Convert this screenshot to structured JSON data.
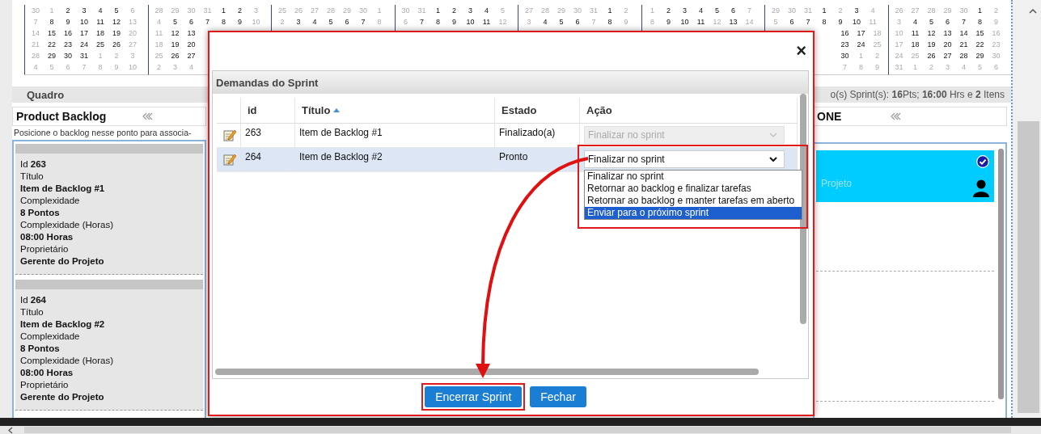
{
  "calendar": {
    "months": [
      {
        "kind": "whole",
        "weeks": [
          {
            "days": [
              "30",
              "1",
              "2",
              "3",
              "4",
              "5",
              "6"
            ],
            "muted": [
              true,
              true,
              false,
              false,
              false,
              false,
              true
            ]
          },
          {
            "days": [
              "7",
              "8",
              "9",
              "10",
              "11",
              "12",
              "13"
            ],
            "muted": [
              true,
              false,
              false,
              false,
              false,
              false,
              true
            ]
          },
          {
            "days": [
              "14",
              "15",
              "16",
              "17",
              "18",
              "19",
              "20"
            ],
            "muted": [
              true,
              false,
              false,
              false,
              false,
              false,
              true
            ]
          },
          {
            "days": [
              "21",
              "22",
              "23",
              "24",
              "25",
              "26",
              "27"
            ],
            "muted": [
              true,
              false,
              false,
              false,
              false,
              false,
              true
            ]
          },
          {
            "days": [
              "28",
              "29",
              "30",
              "31",
              "1",
              "2",
              "3"
            ],
            "muted": [
              true,
              false,
              false,
              false,
              true,
              true,
              true
            ]
          },
          {
            "days": [
              "4",
              "5",
              "6",
              "7",
              "8",
              "9",
              "10"
            ],
            "muted": [
              true,
              true,
              true,
              true,
              true,
              true,
              true
            ]
          }
        ]
      },
      {
        "kind": "cut_right",
        "weeks": [
          {
            "days": [
              "28",
              "29",
              "30",
              "31",
              "1",
              "2",
              "3"
            ],
            "muted": [
              true,
              true,
              true,
              true,
              false,
              false,
              true
            ]
          },
          {
            "days": [
              "4",
              "5",
              "6",
              "7",
              "8",
              "9",
              "10"
            ],
            "muted": [
              true,
              false,
              false,
              false,
              false,
              false,
              true
            ]
          },
          {
            "days": [
              "11",
              "12",
              "13"
            ],
            "muted": [
              true,
              false,
              false
            ]
          },
          {
            "days": [
              "18",
              "19",
              "20"
            ],
            "muted": [
              true,
              false,
              false
            ]
          },
          {
            "days": [
              "25",
              "26",
              "27"
            ],
            "muted": [
              true,
              false,
              false
            ]
          },
          {
            "days": [
              "2",
              "3",
              "4"
            ],
            "muted": [
              true,
              true,
              true
            ]
          }
        ]
      },
      {
        "kind": "whole",
        "weeks": [
          {
            "days": [
              "25",
              "26",
              "27",
              "28",
              "29",
              "30",
              "1"
            ],
            "muted": [
              true,
              true,
              true,
              true,
              true,
              true,
              true
            ]
          },
          {
            "days": [
              "2",
              "3",
              "4",
              "5",
              "6",
              "7",
              "8"
            ],
            "muted": [
              true,
              false,
              false,
              false,
              false,
              false,
              true
            ]
          }
        ]
      },
      {
        "kind": "whole",
        "weeks": [
          {
            "days": [
              "30",
              "31",
              "1",
              "2",
              "3",
              "4",
              "5"
            ],
            "muted": [
              true,
              true,
              false,
              false,
              false,
              false,
              true
            ]
          },
          {
            "days": [
              "6",
              "7",
              "8",
              "9",
              "10",
              "11",
              "12"
            ],
            "muted": [
              true,
              false,
              false,
              false,
              false,
              false,
              true
            ]
          }
        ]
      },
      {
        "kind": "whole",
        "weeks": [
          {
            "days": [
              "27",
              "28",
              "29",
              "30",
              "31",
              "1",
              "2"
            ],
            "muted": [
              true,
              true,
              true,
              true,
              true,
              false,
              true
            ]
          },
          {
            "days": [
              "3",
              "4",
              "5",
              "6",
              "7",
              "8",
              "9"
            ],
            "muted": [
              true,
              false,
              false,
              false,
              true,
              false,
              true
            ]
          }
        ]
      },
      {
        "kind": "whole",
        "weeks": [
          {
            "days": [
              "1",
              "2",
              "3",
              "4",
              "5",
              "6",
              "7"
            ],
            "muted": [
              true,
              false,
              false,
              false,
              false,
              false,
              true
            ]
          },
          {
            "days": [
              "8",
              "9",
              "10",
              "11",
              "12",
              "13",
              "14"
            ],
            "muted": [
              true,
              false,
              false,
              false,
              true,
              false,
              true
            ]
          }
        ]
      },
      {
        "kind": "cut_left",
        "weeks": [
          {
            "days": [
              "29",
              "30",
              "31",
              "1",
              "2",
              "3",
              "4"
            ],
            "muted": [
              true,
              true,
              true,
              false,
              true,
              false,
              true
            ]
          },
          {
            "days": [
              "5",
              "6",
              "7",
              "8",
              "9",
              "10",
              "11"
            ],
            "muted": [
              true,
              false,
              false,
              false,
              false,
              false,
              true
            ]
          },
          {
            "days": [
              "16",
              "17",
              "18"
            ],
            "muted": [
              false,
              false,
              true
            ]
          },
          {
            "days": [
              "23",
              "24",
              "25"
            ],
            "muted": [
              false,
              false,
              true
            ]
          },
          {
            "days": [
              "30",
              "1",
              "2"
            ],
            "muted": [
              false,
              true,
              true
            ]
          },
          {
            "days": [
              "7",
              "8",
              "9"
            ],
            "muted": [
              true,
              true,
              true
            ]
          }
        ]
      },
      {
        "kind": "whole",
        "weeks": [
          {
            "days": [
              "26",
              "27",
              "28",
              "29",
              "30",
              "1",
              "2"
            ],
            "muted": [
              true,
              true,
              true,
              true,
              true,
              false,
              true
            ]
          },
          {
            "days": [
              "3",
              "4",
              "5",
              "6",
              "7",
              "8",
              "9"
            ],
            "muted": [
              true,
              false,
              false,
              false,
              false,
              false,
              true
            ]
          },
          {
            "days": [
              "10",
              "11",
              "12",
              "13",
              "14",
              "15",
              "16"
            ],
            "muted": [
              true,
              false,
              false,
              false,
              false,
              false,
              true
            ]
          },
          {
            "days": [
              "17",
              "18",
              "19",
              "20",
              "21",
              "22",
              "23"
            ],
            "muted": [
              true,
              false,
              false,
              false,
              false,
              false,
              true
            ]
          },
          {
            "days": [
              "24",
              "25",
              "26",
              "27",
              "28",
              "29",
              "30"
            ],
            "muted": [
              true,
              true,
              false,
              false,
              false,
              false,
              true
            ]
          },
          {
            "days": [
              "31",
              "1",
              "2",
              "3",
              "4",
              "5",
              "6"
            ],
            "muted": [
              true,
              true,
              true,
              true,
              true,
              true,
              true
            ]
          }
        ]
      }
    ]
  },
  "board_tab": "Quadro",
  "sprint_summary": "o(s) Sprint(s): **16**Pts; **16:00** Hrs e **2** Itens",
  "backlog": {
    "title": "Product Backlog",
    "hint": "Posicione o backlog nesse ponto para associa-",
    "items": [
      {
        "id_label": "Id",
        "id": "263",
        "fields": [
          {
            "label": "Título",
            "value": "Item de Backlog #1"
          },
          {
            "label": "Complexidade",
            "value": "8 Pontos"
          },
          {
            "label": "Complexidade (Horas)",
            "value": "08:00 Horas"
          },
          {
            "label": "Proprietário",
            "value": "Gerente do Projeto"
          }
        ]
      },
      {
        "id_label": "Id",
        "id": "264",
        "fields": [
          {
            "label": "Título",
            "value": "Item de Backlog #2"
          },
          {
            "label": "Complexidade",
            "value": "8 Pontos"
          },
          {
            "label": "Complexidade (Horas)",
            "value": "08:00 Horas"
          },
          {
            "label": "Proprietário",
            "value": "Gerente do Projeto"
          }
        ]
      }
    ]
  },
  "sprint_column": {
    "title": "ONE",
    "cards": [
      {
        "text": "Projeto",
        "checked": true
      }
    ]
  },
  "dialog": {
    "close": "×",
    "panel_title": "Demandas do Sprint",
    "columns": [
      {
        "label": "id",
        "sorted": false
      },
      {
        "label": "Título",
        "sorted": true
      },
      {
        "label": "Estado",
        "sorted": false
      },
      {
        "label": "Ação",
        "sorted": false
      }
    ],
    "rows": [
      {
        "id": "263",
        "title": "Item de Backlog #1",
        "state": "Finalizado(a)",
        "action": "Finalizar no sprint",
        "disabled": true,
        "selected": false
      },
      {
        "id": "264",
        "title": "Item de Backlog #2",
        "state": "Pronto",
        "action": "Finalizar no sprint",
        "disabled": false,
        "selected": true
      }
    ],
    "dropdown": {
      "options": [
        {
          "label": "Finalizar no sprint",
          "selected": false
        },
        {
          "label": "Retornar ao backlog e finalizar tarefas",
          "selected": false
        },
        {
          "label": "Retornar ao backlog e manter tarefas em aberto",
          "selected": false
        },
        {
          "label": "Enviar para o próximo sprint",
          "selected": true
        }
      ]
    },
    "buttons": [
      {
        "label": "Encerrar Sprint",
        "highlighted": true
      },
      {
        "label": "Fechar",
        "highlighted": false
      }
    ]
  }
}
